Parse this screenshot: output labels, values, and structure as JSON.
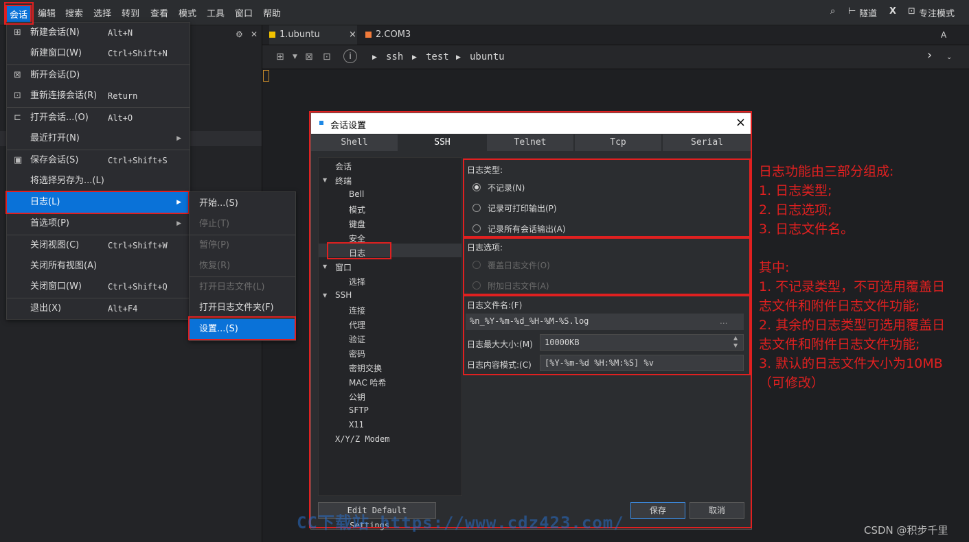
{
  "menubar": {
    "items": [
      "会话",
      "编辑",
      "搜索",
      "选择",
      "转到",
      "查看",
      "模式",
      "工具",
      "窗口",
      "帮助"
    ],
    "right": {
      "tunnel": "隧道",
      "x": "X",
      "focus": "专注模式"
    }
  },
  "tabs": [
    {
      "label": "1.ubuntu",
      "color": "#f2c200",
      "close": "×"
    },
    {
      "label": "2.COM3",
      "color": "#f07a3a"
    }
  ],
  "tabbar_right": "A",
  "breadcrumb": [
    "ssh",
    "test",
    "ubuntu"
  ],
  "session_menu": {
    "items": [
      {
        "label": "新建会话(N)",
        "shortcut": "Alt+N"
      },
      {
        "label": "新建窗口(W)",
        "shortcut": "Ctrl+Shift+N"
      },
      {
        "label": "断开会话(D)",
        "shortcut": ""
      },
      {
        "label": "重新连接会话(R)",
        "shortcut": "Return"
      },
      {
        "label": "打开会话...(O)",
        "shortcut": "Alt+O"
      },
      {
        "label": "最近打开(N)",
        "shortcut": ""
      },
      {
        "label": "保存会话(S)",
        "shortcut": "Ctrl+Shift+S"
      },
      {
        "label": "将选择另存为...(L)",
        "shortcut": ""
      },
      {
        "label": "日志(L)",
        "shortcut": ""
      },
      {
        "label": "首选项(P)",
        "shortcut": ""
      },
      {
        "label": "关闭视图(C)",
        "shortcut": "Ctrl+Shift+W"
      },
      {
        "label": "关闭所有视图(A)",
        "shortcut": ""
      },
      {
        "label": "关闭窗口(W)",
        "shortcut": "Ctrl+Shift+Q"
      },
      {
        "label": "退出(X)",
        "shortcut": "Alt+F4"
      }
    ]
  },
  "log_submenu": {
    "items": [
      "开始...(S)",
      "停止(T)",
      "暂停(P)",
      "恢复(R)",
      "打开日志文件(L)",
      "打开日志文件夹(F)",
      "设置...(S)"
    ]
  },
  "dialog": {
    "title": "会话设置",
    "close": "×",
    "tabs": [
      "Shell",
      "SSH",
      "Telnet",
      "Tcp",
      "Serial"
    ],
    "tree": {
      "session": "会话",
      "terminal": "终端",
      "terminal_children": [
        "Bell",
        "模式",
        "键盘",
        "安全",
        "日志"
      ],
      "window": "窗口",
      "window_children": [
        "选择"
      ],
      "ssh": "SSH",
      "ssh_children": [
        "连接",
        "代理",
        "验证",
        "密码",
        "密钥交换",
        "MAC 哈希",
        "公钥",
        "SFTP",
        "X11"
      ],
      "xyz": "X/Y/Z Modem"
    },
    "log_type": {
      "label": "日志类型:",
      "options": [
        "不记录(N)",
        "记录可打印输出(P)",
        "记录所有会话输出(A)"
      ]
    },
    "log_options": {
      "label": "日志选项:",
      "options": [
        "覆盖日志文件(O)",
        "附加日志文件(A)"
      ]
    },
    "log_file": {
      "label": "日志文件名:(F)",
      "value": "%n_%Y-%m-%d_%H-%M-%S.log",
      "browse": "...",
      "max_size_label": "日志最大大小:(M)",
      "max_size_value": "10000KB",
      "pattern_label": "日志内容模式:(C)",
      "pattern_value": "[%Y-%m-%d %H:%M:%S] %v"
    },
    "buttons": {
      "edit_default": "Edit Default Settings...",
      "save": "保存",
      "cancel": "取消"
    }
  },
  "annotation": {
    "lines": [
      "日志功能由三部分组成:",
      "1. 日志类型;",
      "2. 日志选项;",
      "3. 日志文件名。",
      "",
      "其中:",
      "1. 不记录类型，不可选用覆盖日",
      "志文件和附件日志文件功能;",
      "2. 其余的日志类型可选用覆盖日",
      "志文件和附件日志文件功能;",
      "3. 默认的日志文件大小为10MB",
      "（可修改）"
    ]
  },
  "watermark": "CC下载站 https://www.cdz423.com/",
  "credit": "CSDN @积步千里"
}
